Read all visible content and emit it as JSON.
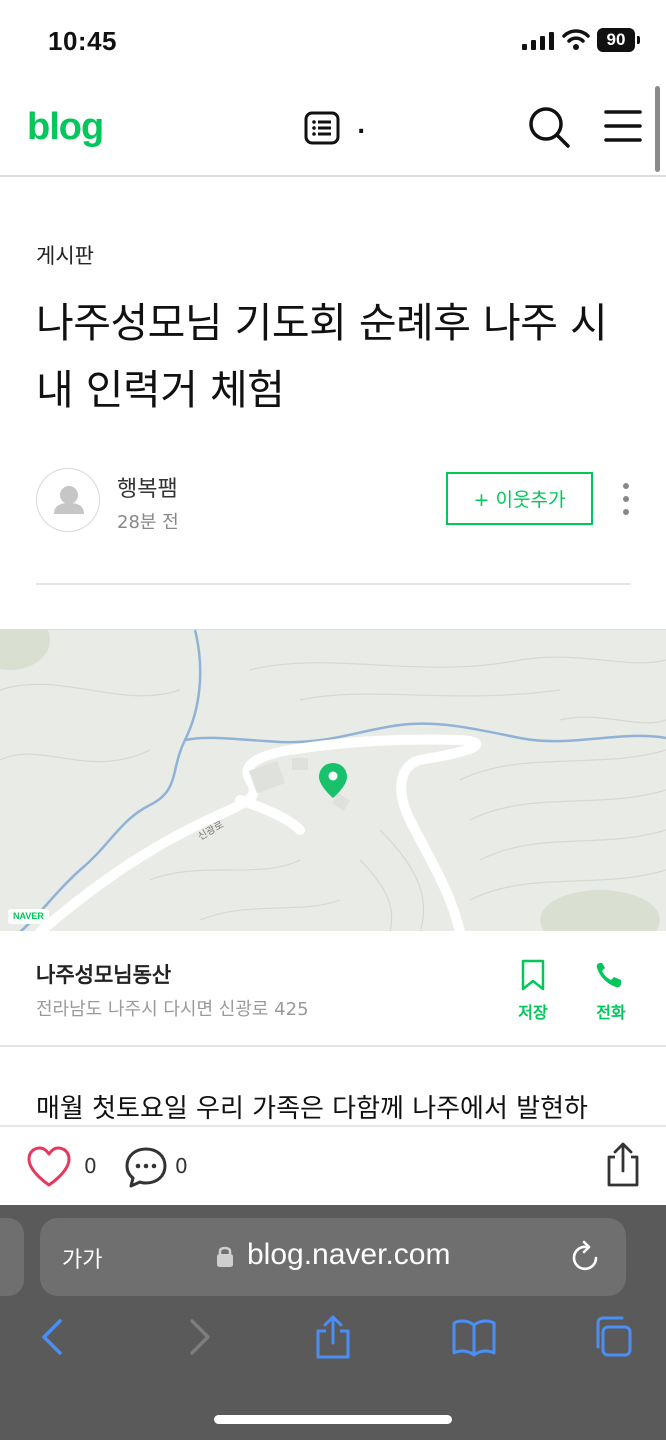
{
  "status_bar": {
    "time": "10:45",
    "battery": "90"
  },
  "header": {
    "logo": "blog",
    "separator": "."
  },
  "post": {
    "category": "게시판",
    "title": "나주성모님 기도회 순례후 나주 시내 인력거 체험",
    "author": "행복팸",
    "time": "28분 전",
    "neighbor_label": "+ 이웃추가"
  },
  "map": {
    "road_label": "신광로",
    "badge": "NAVER"
  },
  "place": {
    "name": "나주성모님동산",
    "address": "전라남도 나주시 다시면 신광로 425",
    "save_label": "저장",
    "call_label": "전화"
  },
  "body_text": "매월 첫토요일 우리 가족은 다함께 나주에서 발현하",
  "actions": {
    "like_count": "0",
    "comment_count": "0"
  },
  "browser": {
    "text_size_label": "가가",
    "url": "blog.naver.com"
  },
  "colors": {
    "accent": "#03c75a",
    "like": "#e8365d",
    "safari_blue": "#4a8ff5"
  },
  "icons": [
    "post-list-icon",
    "search-icon",
    "menu-icon",
    "more-icon",
    "bookmark-icon",
    "phone-icon",
    "heart-icon",
    "comment-icon",
    "share-icon",
    "lock-icon",
    "reload-icon",
    "back-icon",
    "forward-icon",
    "bookmarks-icon",
    "tabs-icon",
    "map-pin-icon"
  ]
}
